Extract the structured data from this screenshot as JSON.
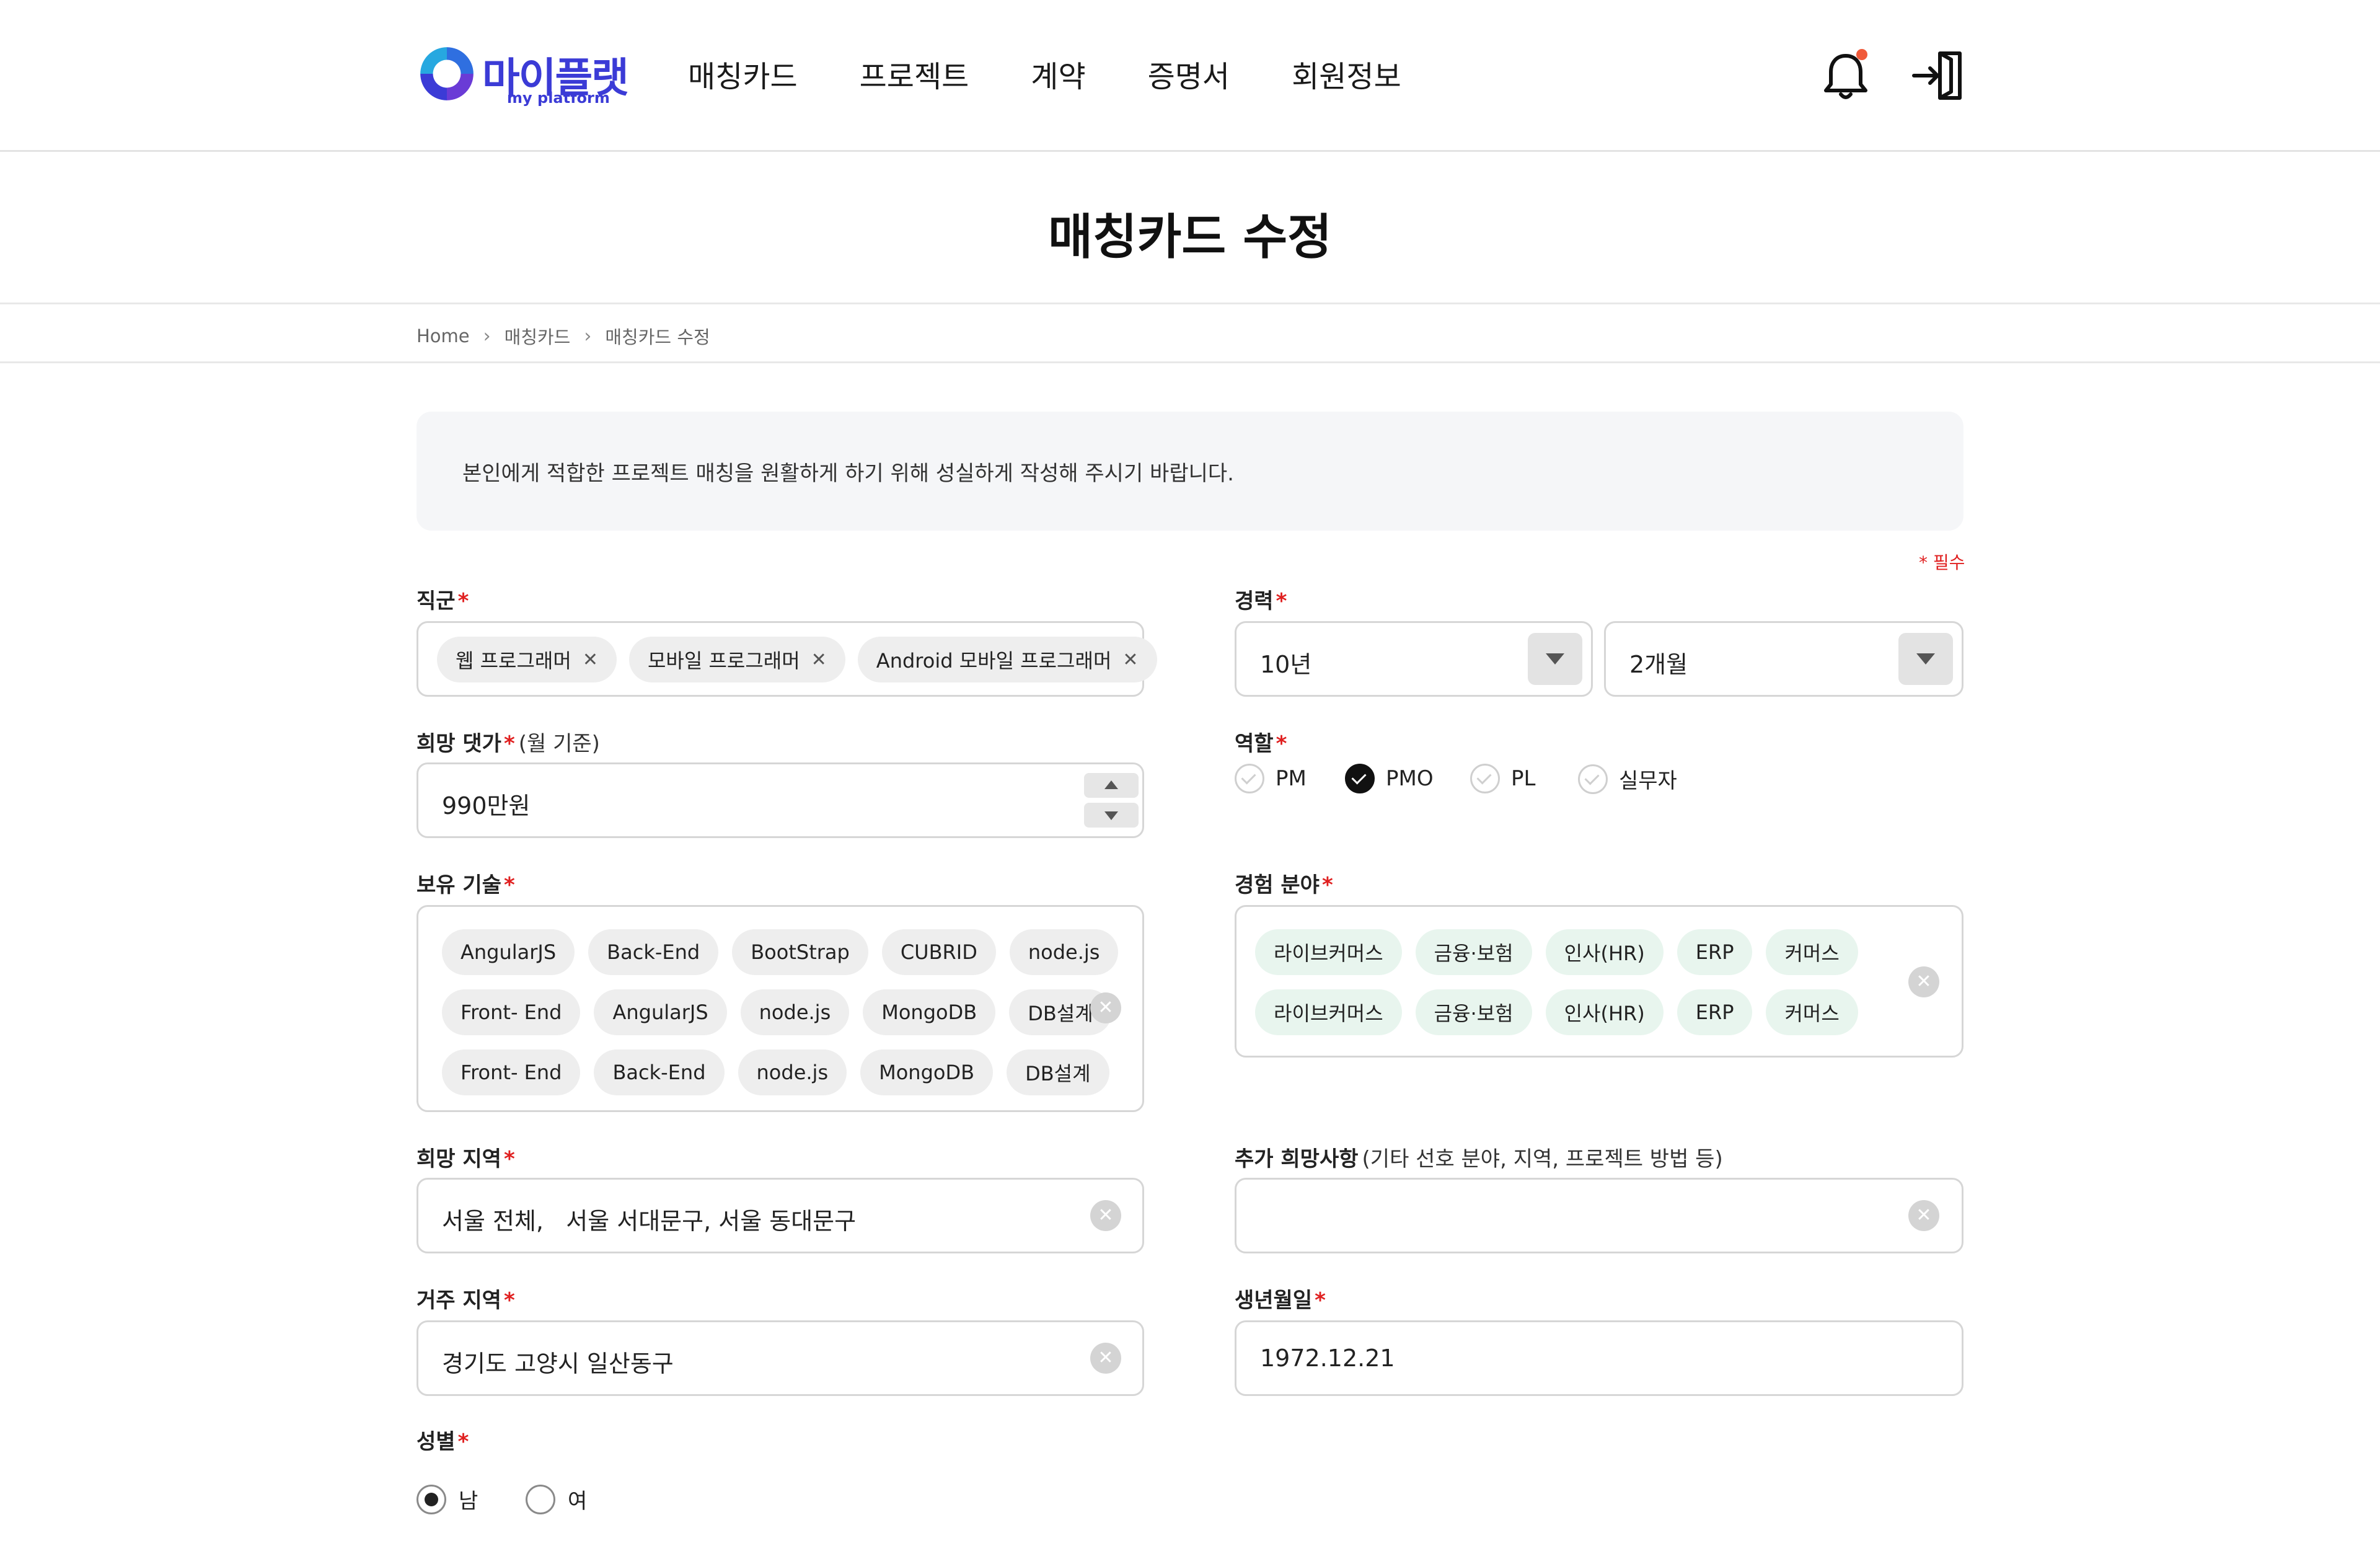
{
  "logo": {
    "name": "마이플랫",
    "sub": "my platform"
  },
  "nav": [
    "매칭카드",
    "프로젝트",
    "계약",
    "증명서",
    "회원정보"
  ],
  "header_icons": {
    "notification": "bell-icon",
    "logout": "logout-icon"
  },
  "page_title": "매칭카드 수정",
  "breadcrumb": [
    "Home",
    "매칭카드",
    "매칭카드 수정"
  ],
  "notice": "본인에게 적합한 프로젝트 매칭을 원활하게 하기 위해 성실하게 작성해 주시기 바랍니다.",
  "required_legend": "* 필수",
  "form": {
    "job_group": {
      "label": "직군",
      "tags": [
        "웹 프로그래머",
        "모바일 프로그래머",
        "Android 모바일 프로그래머"
      ]
    },
    "career": {
      "label": "경력",
      "years": "10년",
      "months": "2개월"
    },
    "desired_pay": {
      "label": "희망 댓가",
      "aux": "(월 기준)",
      "value": "990만원"
    },
    "role": {
      "label": "역할",
      "options": [
        "PM",
        "PMO",
        "PL",
        "실무자"
      ],
      "selected": "PMO"
    },
    "skills": {
      "label": "보유 기술",
      "rows": [
        [
          "AngularJS",
          "Back-End",
          "BootStrap",
          "CUBRID",
          "node.js"
        ],
        [
          "Front- End",
          "AngularJS",
          "node.js",
          "MongoDB",
          "DB설계"
        ],
        [
          "Front- End",
          "Back-End",
          "node.js",
          "MongoDB",
          "DB설계"
        ]
      ]
    },
    "experience_fields": {
      "label": "경험 분야",
      "rows": [
        [
          "라이브커머스",
          "금융·보험",
          "인사(HR)",
          "ERP",
          "커머스"
        ],
        [
          "라이브커머스",
          "금융·보험",
          "인사(HR)",
          "ERP",
          "커머스"
        ]
      ]
    },
    "desired_region": {
      "label": "희망 지역",
      "value": "서울 전체,   서울 서대문구, 서울 동대문구"
    },
    "extra_request": {
      "label": "추가 희망사항",
      "aux": "(기타 선호 분야, 지역, 프로젝트 방법 등)",
      "value": ""
    },
    "residence": {
      "label": "거주 지역",
      "value": "경기도 고양시 일산동구"
    },
    "birthdate": {
      "label": "생년월일",
      "value": "1972.12.21"
    },
    "gender": {
      "label": "성별",
      "options": [
        "남",
        "여"
      ],
      "selected": "남"
    }
  },
  "colors": {
    "accent": "#3b3bd6",
    "required": "#e02020",
    "chip": "#eeeeee",
    "chip_green": "#e8f5ee",
    "notice_bg": "#f5f6f8"
  }
}
